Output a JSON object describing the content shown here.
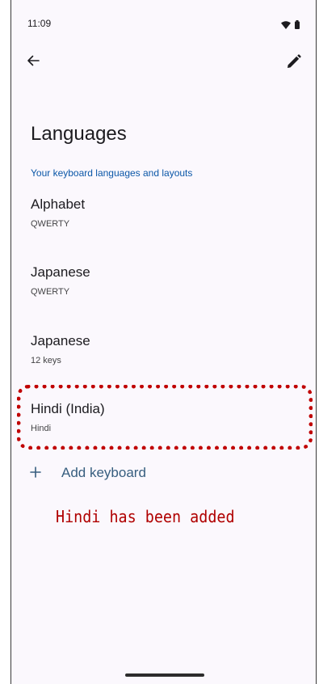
{
  "status_bar": {
    "time": "11:09",
    "icons": [
      "wifi-icon",
      "battery-icon"
    ]
  },
  "toolbar": {
    "back_icon": "arrow-back-icon",
    "edit_icon": "pencil-icon"
  },
  "page": {
    "title": "Languages",
    "section_header": "Your keyboard languages and layouts"
  },
  "languages": [
    {
      "name": "Alphabet",
      "layout": "QWERTY"
    },
    {
      "name": "Japanese",
      "layout": "QWERTY"
    },
    {
      "name": "Japanese",
      "layout": "12 keys"
    },
    {
      "name": "Hindi (India)",
      "layout": "Hindi"
    }
  ],
  "add_keyboard": {
    "icon": "plus-icon",
    "label": "Add keyboard"
  },
  "annotation": {
    "text": "Hindi has been added",
    "color": "#b00000",
    "highlight_color": "#c00000"
  },
  "colors": {
    "accent": "#0b57a8",
    "link": "#375e7f",
    "background": "#fbf8fd"
  }
}
